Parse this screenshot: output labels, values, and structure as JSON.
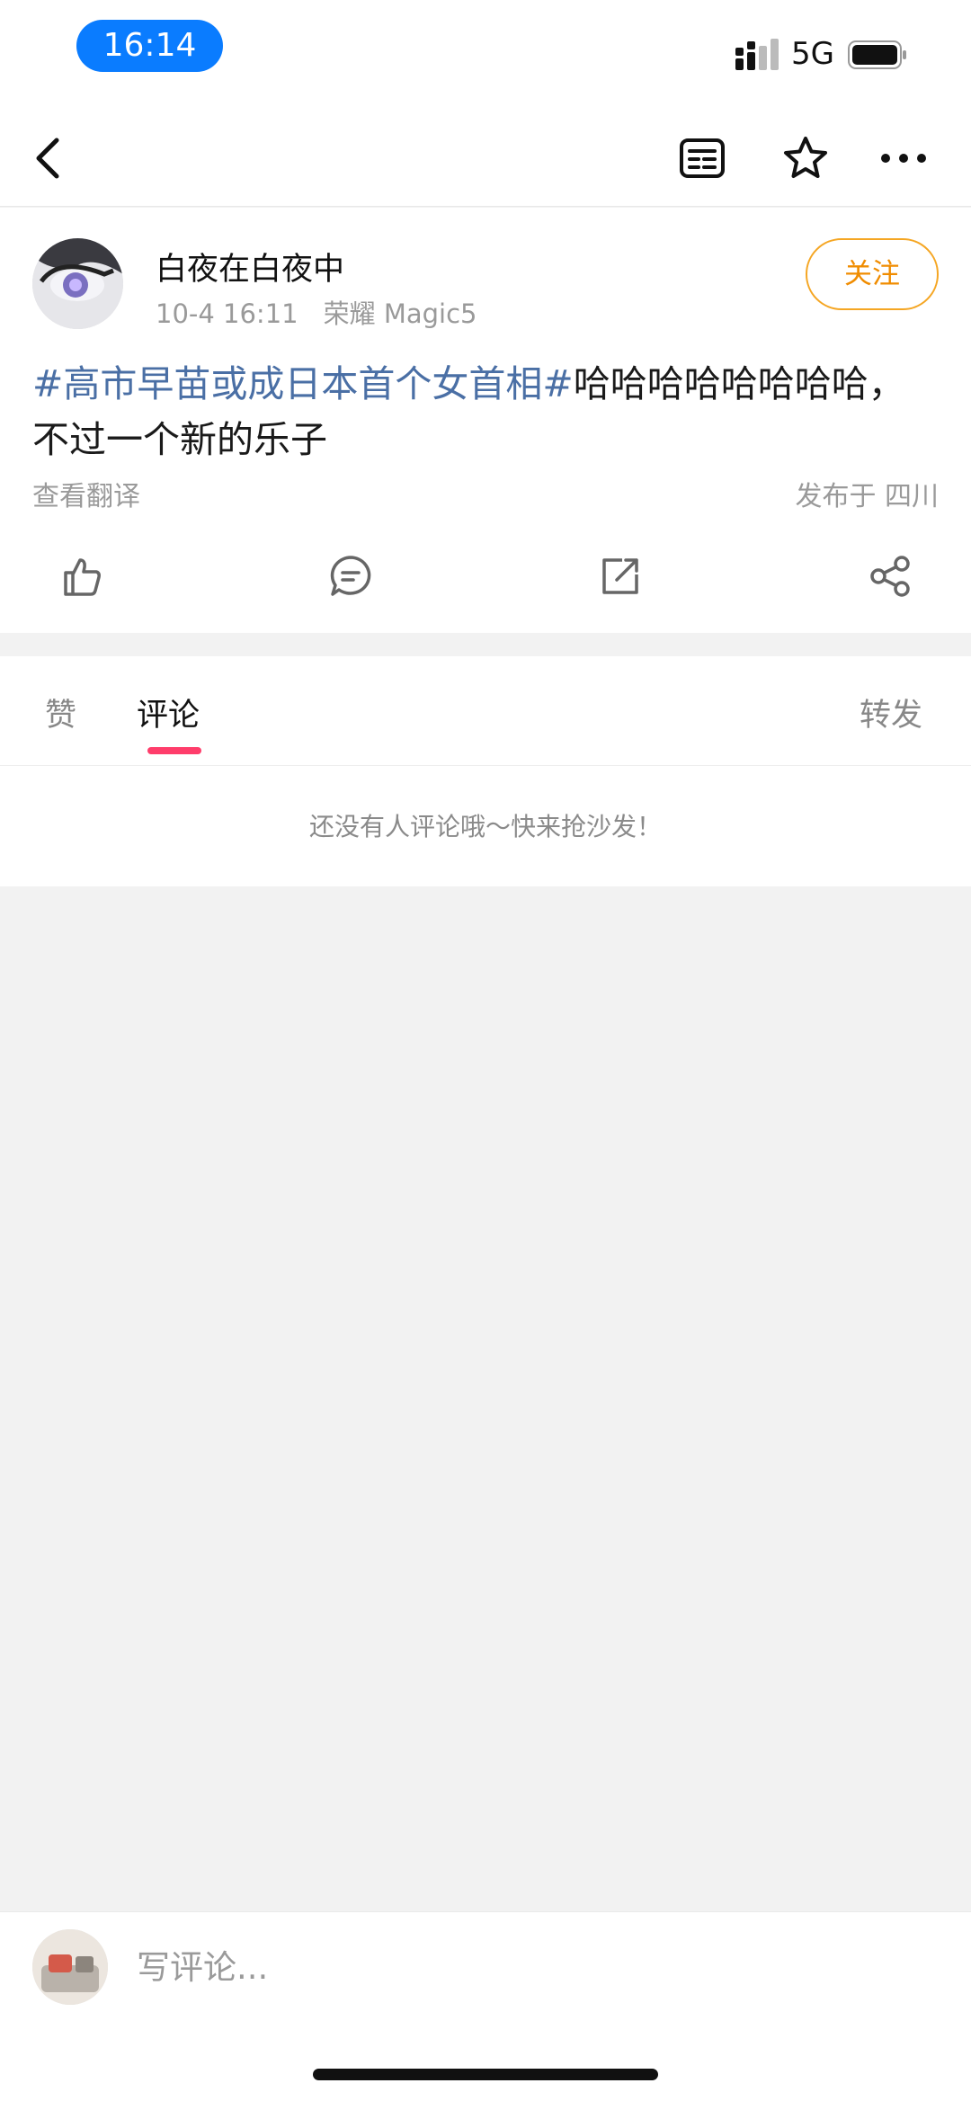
{
  "status_bar": {
    "time": "16:14",
    "network": "5G"
  },
  "post": {
    "author": "白夜在白夜中",
    "timestamp": "10-4 16:11",
    "device": "荣耀 Magic5",
    "follow_label": "关注",
    "topic": "#高市早苗或成日本首个女首相#",
    "text": "哈哈哈哈哈哈哈哈，不过一个新的乐子",
    "translate_label": "查看翻译",
    "location": "发布于 四川"
  },
  "tabs": [
    {
      "label": "赞"
    },
    {
      "label": "评论"
    },
    {
      "label": "转发"
    }
  ],
  "comments": {
    "empty_message": "还没有人评论哦～快来抢沙发！"
  },
  "comment_bar": {
    "placeholder": "写评论..."
  },
  "colors": {
    "accent_blue": "#0a7cff",
    "topic_blue": "#4a6fa5",
    "follow_orange": "#f08c00",
    "tab_indicator": "#ff3d6b"
  }
}
